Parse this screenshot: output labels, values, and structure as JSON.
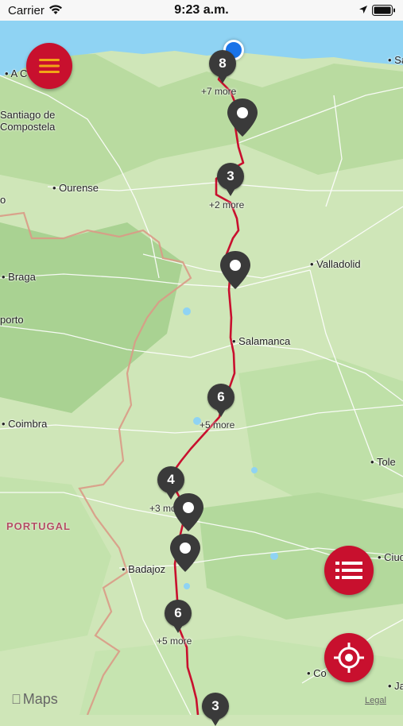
{
  "status_bar": {
    "carrier": "Carrier",
    "time": "9:23 a.m."
  },
  "map": {
    "places": [
      {
        "name": "A C",
        "id": "a-coruna"
      },
      {
        "name": "Santiago de Compostela",
        "id": "santiago"
      },
      {
        "name": "o",
        "id": "o"
      },
      {
        "name": "Ourense",
        "id": "ourense"
      },
      {
        "name": "Braga",
        "id": "braga"
      },
      {
        "name": "porto",
        "id": "porto"
      },
      {
        "name": "Valladolid",
        "id": "valladolid"
      },
      {
        "name": "Salamanca",
        "id": "salamanca"
      },
      {
        "name": "Coimbra",
        "id": "coimbra"
      },
      {
        "name": "Tole",
        "id": "toledo"
      },
      {
        "name": "Badajoz",
        "id": "badajoz"
      },
      {
        "name": "Ciud",
        "id": "ciudad"
      },
      {
        "name": "Co",
        "id": "co"
      },
      {
        "name": "Ja",
        "id": "ja"
      },
      {
        "name": "Sa",
        "id": "sa"
      }
    ],
    "country_label": "PORTUGAL",
    "clusters": [
      {
        "count": "8",
        "more": "+7 more"
      },
      {
        "count": "3",
        "more": "+2 more"
      },
      {
        "count": "6",
        "more": "+5 more"
      },
      {
        "count": "4",
        "more": "+3 more"
      },
      {
        "count": "6",
        "more": "+5 more"
      },
      {
        "count": "3",
        "more": ""
      }
    ],
    "attribution": {
      "brand": "Maps",
      "legal": "Legal"
    }
  },
  "colors": {
    "route": "#c8102e",
    "accent": "#c8102e",
    "cluster": "#3a3a3a",
    "water": "#8fd3f3",
    "land": "#cfe6b8"
  },
  "controls": {
    "menu_icon": "hamburger-icon",
    "list_icon": "list-icon",
    "locate_icon": "crosshair-icon"
  }
}
